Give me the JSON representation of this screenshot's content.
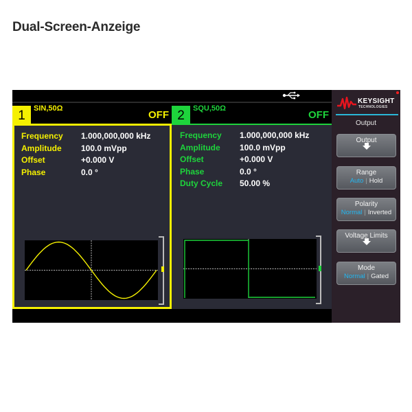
{
  "page_title": "Dual-Screen-Anzeige",
  "colors": {
    "channel1": "#f5f000",
    "channel2": "#1ed43c",
    "selected_option": "#22b6f0",
    "brand_red": "#e8141e",
    "panel_bg": "#2a2b36",
    "softkey_bg": "#2b2029"
  },
  "status_bar": {
    "usb_icon": "usb-icon"
  },
  "channels": [
    {
      "number": "1",
      "info": "SIN,50Ω",
      "output_state": "OFF",
      "waveform": "sine",
      "params": [
        {
          "label": "Frequency",
          "value": "1.000,000,000 kHz"
        },
        {
          "label": "Amplitude",
          "value": "100.0 mVpp"
        },
        {
          "label": "Offset",
          "value": "+0.000 V"
        },
        {
          "label": "Phase",
          "value": "0.0 °"
        }
      ]
    },
    {
      "number": "2",
      "info": "SQU,50Ω",
      "output_state": "OFF",
      "waveform": "square",
      "params": [
        {
          "label": "Frequency",
          "value": "1.000,000,000 kHz"
        },
        {
          "label": "Amplitude",
          "value": "100.0 mVpp"
        },
        {
          "label": "Offset",
          "value": "+0.000 V"
        },
        {
          "label": "Phase",
          "value": "0.0 °"
        },
        {
          "label": "Duty Cycle",
          "value": "50.00 %"
        }
      ]
    }
  ],
  "softkeys": {
    "brand": "KEYSIGHT",
    "brand_sub": "TECHNOLOGIES",
    "menu_title": "Output",
    "buttons": [
      {
        "label": "Output",
        "type": "submenu"
      },
      {
        "label": "Range",
        "options": [
          "Auto",
          "Hold"
        ],
        "selected": "Auto"
      },
      {
        "label": "Polarity",
        "options": [
          "Normal",
          "Inverted"
        ],
        "selected": "Normal"
      },
      {
        "label": "Voltage Limits",
        "type": "submenu"
      },
      {
        "label": "Mode",
        "options": [
          "Normal",
          "Gated"
        ],
        "selected": "Normal"
      }
    ]
  }
}
